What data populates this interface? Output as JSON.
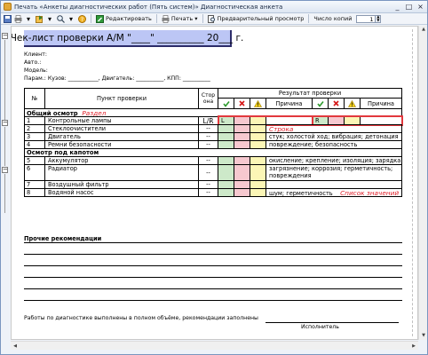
{
  "window": {
    "title": "Печать «Анкеты диагностических работ (Пять систем)» Диагностическая анкета",
    "controls": [
      "_",
      "□",
      "×"
    ]
  },
  "toolbar": {
    "edit_label": "Редактировать",
    "print_label": "Печать",
    "preview_label": "Предварительный просмотр",
    "copies_label": "Число копий",
    "copies_value": "1"
  },
  "doc": {
    "header": "Чек-лист проверки А/М \"____\" __________ 20___ г.",
    "client_label": "Клиент:",
    "auto_label": "Авто.:",
    "model_label": "Модель:",
    "params_line": "Парам.:  Кузов: ___________, Двигатель: __________, КПП: __________",
    "col_num": "№",
    "col_item": "Пункт проверки",
    "col_side": "Стор она",
    "col_result": "Результат проверки",
    "col_reason": "Причина",
    "sections": [
      {
        "title": "Общий осмотр",
        "annotation": "Раздел",
        "rows": [
          {
            "num": "1",
            "name": "Контрольные лампы",
            "side": "L/R",
            "left_val": "L",
            "reason1": "",
            "right_val": "R",
            "reason2": ""
          },
          {
            "num": "2",
            "name": "Стеклоочистители",
            "side": "--",
            "reason1": "Строка",
            "reason2": ""
          },
          {
            "num": "3",
            "name": "Двигатель",
            "side": "--",
            "reason1": "стук; холостой ход; вибрация; детонация",
            "reason2": ""
          },
          {
            "num": "4",
            "name": "Ремни безопасности",
            "side": "--",
            "reason1": "повреждение; безопасность",
            "reason2": ""
          }
        ]
      },
      {
        "title": "Осмотр под капотом",
        "annotation": "",
        "rows": [
          {
            "num": "5",
            "name": "Аккумулятор",
            "side": "--",
            "reason1": "окисление; крепление; изоляция; зарядка",
            "reason2": ""
          },
          {
            "num": "6",
            "name": "Радиатор",
            "side": "--",
            "reason1": "загрязнение; коррозия; герметичность; повреждения",
            "reason2": ""
          },
          {
            "num": "7",
            "name": "Воздушный фильтр",
            "side": "--",
            "reason1": "",
            "reason2": ""
          },
          {
            "num": "8",
            "name": "Водяной насос",
            "side": "--",
            "reason1": "шум; герметичность",
            "reason2": "Список значений"
          }
        ]
      }
    ],
    "recommendations_title": "Прочие рекомендации",
    "footer_text": "Работы по диагностике выполнены в полном объёме, рекомендации заполнены",
    "executor_label": "Исполнитель"
  },
  "colors": {
    "header_bg": "#bcc6f5",
    "ok": "#cde9c9",
    "bad": "#f6c8cf",
    "warn": "#fbf6b6",
    "annotation": "#e0202a"
  },
  "icons": [
    "app-icon",
    "save-icon",
    "print-icon",
    "edit-icon",
    "preview-icon",
    "check-icon",
    "cross-icon",
    "warning-icon"
  ]
}
